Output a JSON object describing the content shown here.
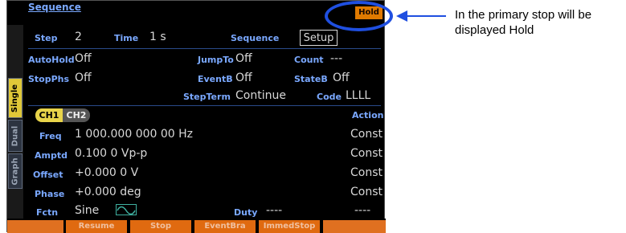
{
  "header": {
    "title": "Sequence",
    "hold": "Hold"
  },
  "row1": {
    "step_label": "Step",
    "step_value": "2",
    "time_label": "Time",
    "time_value": "1 s",
    "sequence_label": "Sequence",
    "sequence_value": "Setup"
  },
  "row2": {
    "autohold_label": "AutoHold",
    "autohold_value": "Off",
    "jumpto_label": "JumpTo",
    "jumpto_value": "Off",
    "count_label": "Count",
    "count_value": "---"
  },
  "row3": {
    "stopphs_label": "StopPhs",
    "stopphs_value": "Off",
    "eventb_label": "EventB",
    "eventb_value": "Off",
    "stateb_label": "StateB",
    "stateb_value": "Off"
  },
  "row4": {
    "stepterm_label": "StepTerm",
    "stepterm_value": "Continue",
    "code_label": "Code",
    "code_value": "LLLL"
  },
  "channels": {
    "ch1": "CH1",
    "ch2": "CH2",
    "action_label": "Action"
  },
  "params": [
    {
      "label": "Freq",
      "value": "1 000.000 000 00 Hz",
      "action": "Const"
    },
    {
      "label": "Amptd",
      "value": "0.100 0 Vp-p",
      "action": "Const"
    },
    {
      "label": "Offset",
      "value": "+0.000 0 V",
      "action": "Const"
    },
    {
      "label": "Phase",
      "value": "+0.000 deg",
      "action": "Const"
    }
  ],
  "fctn": {
    "label": "Fctn",
    "value": "Sine",
    "icon": "sine-wave-icon",
    "duty_label": "Duty",
    "duty_value": "----",
    "action": "----"
  },
  "side_tabs": [
    "Single",
    "Dual",
    "Graph"
  ],
  "softkeys": [
    "",
    "Resume",
    "Stop",
    "EventBra",
    "ImmedStop",
    ""
  ],
  "annotation": {
    "text": "In the primary stop will be displayed Hold"
  }
}
